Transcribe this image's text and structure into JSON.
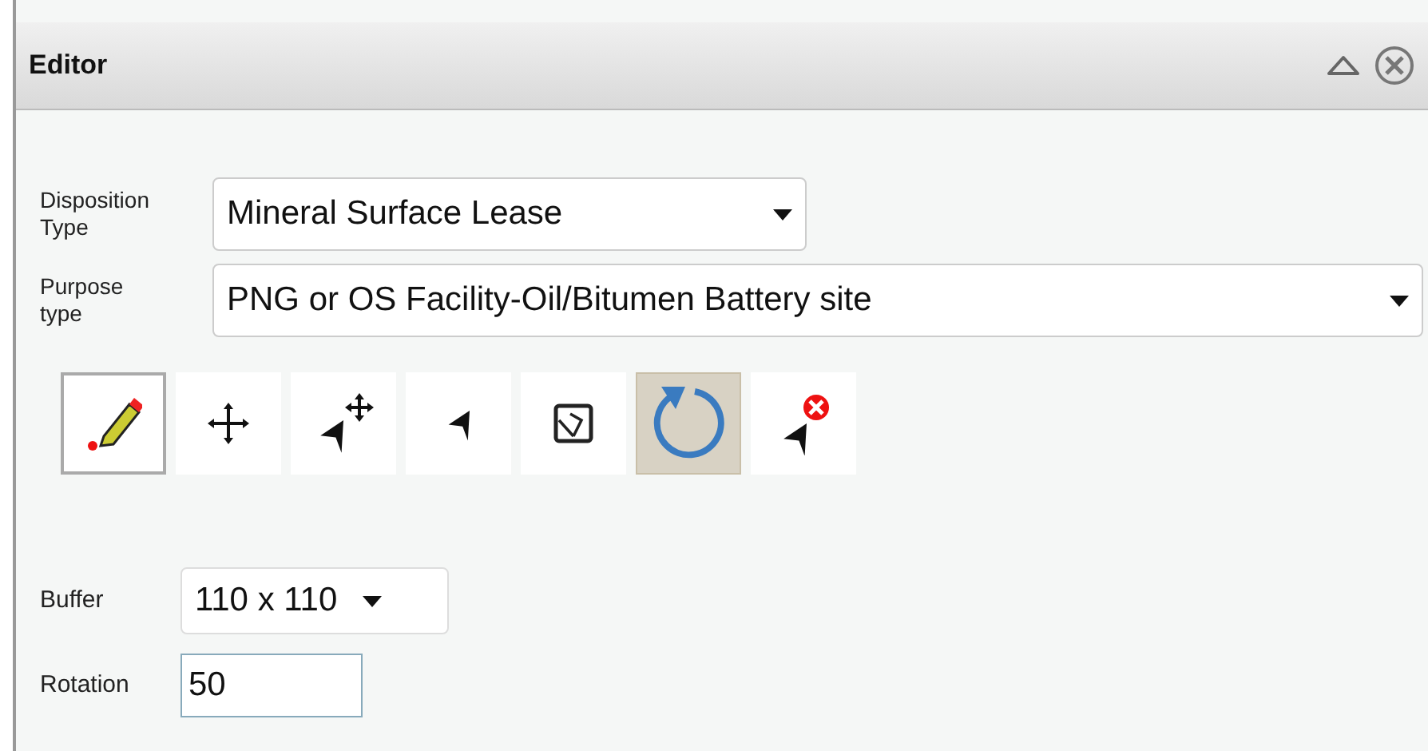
{
  "panel": {
    "title": "Editor"
  },
  "fields": [
    {
      "label": "Disposition Type",
      "value": "Mineral Surface Lease",
      "kind": "select"
    },
    {
      "label": "Purpose type",
      "value": "PNG or OS Facility-Oil/Bitumen Battery site",
      "kind": "select"
    }
  ],
  "tools": [
    {
      "kind": "draw",
      "selected": false,
      "focused": true
    },
    {
      "kind": "move",
      "selected": false,
      "focused": false
    },
    {
      "kind": "select-move",
      "selected": false,
      "focused": false
    },
    {
      "kind": "select",
      "selected": false,
      "focused": false
    },
    {
      "kind": "reshape",
      "selected": false,
      "focused": false
    },
    {
      "kind": "rotate",
      "selected": true,
      "focused": false
    },
    {
      "kind": "delete",
      "selected": false,
      "focused": false
    }
  ],
  "buffer": {
    "label": "Buffer",
    "value": "110 x 110"
  },
  "rotation": {
    "label": "Rotation",
    "value": "50"
  }
}
